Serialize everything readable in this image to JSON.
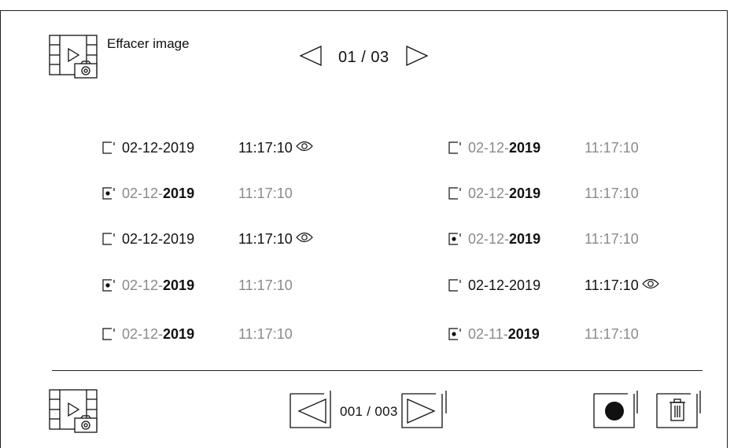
{
  "header": {
    "title": "Effacer image",
    "page_indicator": "01 / 03",
    "icon": "film-camera-icon"
  },
  "list": {
    "left": [
      {
        "date_prefix": "02-12-",
        "year": "2019",
        "time": "11:17:10",
        "checked": false,
        "viewed": true
      },
      {
        "date_prefix": "02-12-",
        "year": "2019",
        "time": "11:17:10",
        "checked": true,
        "viewed": false
      },
      {
        "date_prefix": "02-12-",
        "year": "2019",
        "time": "11:17:10",
        "checked": false,
        "viewed": true
      },
      {
        "date_prefix": "02-12-",
        "year": "2019",
        "time": "11:17:10",
        "checked": true,
        "viewed": false
      },
      {
        "date_prefix": "02-12-",
        "year": "2019",
        "time": "11:17:10",
        "checked": false,
        "viewed": false
      }
    ],
    "right": [
      {
        "date_prefix": "02-12-",
        "year": "2019",
        "time": "11:17:10",
        "checked": false,
        "viewed": false
      },
      {
        "date_prefix": "02-12-",
        "year": "2019",
        "time": "11:17:10",
        "checked": false,
        "viewed": false
      },
      {
        "date_prefix": "02-12-",
        "year": "2019",
        "time": "11:17:10",
        "checked": true,
        "viewed": false
      },
      {
        "date_prefix": "02-12-",
        "year": "2019",
        "time": "11:17:10",
        "checked": false,
        "viewed": true
      },
      {
        "date_prefix": "02-11-",
        "year": "2019",
        "time": "11:17:10",
        "checked": true,
        "viewed": false
      }
    ]
  },
  "footer": {
    "page_indicator": "001 / 003",
    "left_icon": "film-camera-icon",
    "record_icon": "record-icon",
    "delete_icon": "trash-icon"
  },
  "colors": {
    "dark": "#111111",
    "gray": "#8a8a8a",
    "line": "#222222"
  }
}
